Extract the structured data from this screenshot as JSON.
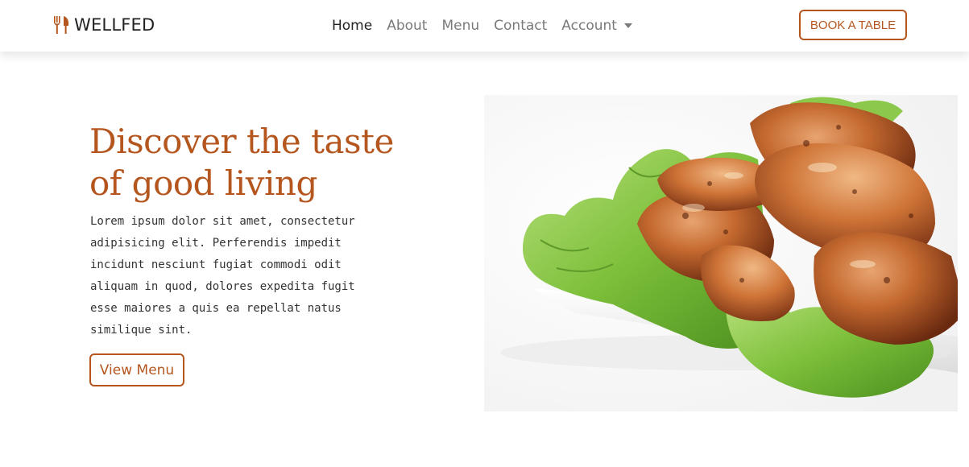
{
  "brand": {
    "name": "WELLFED",
    "icon": "fork-knife-icon",
    "color": "#b5561f"
  },
  "nav": {
    "items": [
      {
        "label": "Home",
        "active": true
      },
      {
        "label": "About",
        "active": false
      },
      {
        "label": "Menu",
        "active": false
      },
      {
        "label": "Contact",
        "active": false
      },
      {
        "label": "Account",
        "active": false,
        "dropdown": true
      }
    ],
    "cta_label": "BOOK A TABLE"
  },
  "hero": {
    "title": "Discover the taste of good living",
    "text": "Lorem ipsum dolor sit amet, consectetur adipisicing elit. Perferendis impedit incidunt nesciunt fugiat commodi odit aliquam in quod, dolores expedita fugit esse maiores a quis ea repellat natus similique sint.",
    "button_label": "View Menu",
    "image": "grilled-chicken-on-lettuce-image"
  },
  "colors": {
    "accent": "#b5561f",
    "text": "#333333",
    "muted": "#7a7a7a"
  }
}
